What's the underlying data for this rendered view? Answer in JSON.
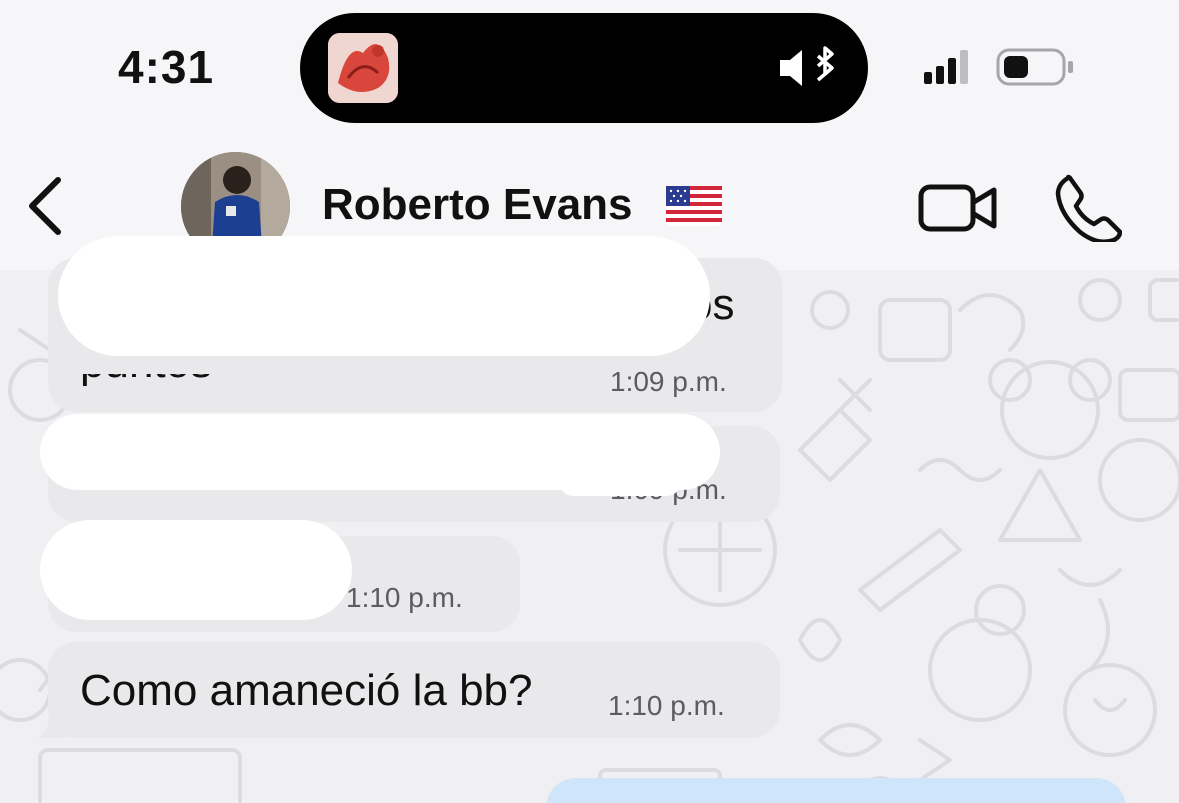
{
  "status_bar": {
    "time": "4:31"
  },
  "header": {
    "contact_name": "Roberto Evans",
    "flag_icon": "us-flag-icon",
    "icons": [
      "back-chevron-icon",
      "video-camera-icon",
      "phone-icon"
    ]
  },
  "messages": [
    {
      "direction": "incoming",
      "text_visible_fragment": "os",
      "text_visible_second_line": "puntos",
      "time": "1:09 p.m.",
      "redacted": true
    },
    {
      "direction": "incoming",
      "time": "1:09 p.m.",
      "redacted": true
    },
    {
      "direction": "incoming",
      "time": "1:10 p.m.",
      "redacted": true
    },
    {
      "direction": "incoming",
      "text": "Como amaneció la bb?",
      "time": "1:10 p.m.",
      "redacted": false
    },
    {
      "direction": "outgoing",
      "redacted": false
    }
  ],
  "colors": {
    "incoming_bubble": "#e9e9eb",
    "outgoing_bubble": "#cfe5fa",
    "redaction": "#ffffff"
  }
}
